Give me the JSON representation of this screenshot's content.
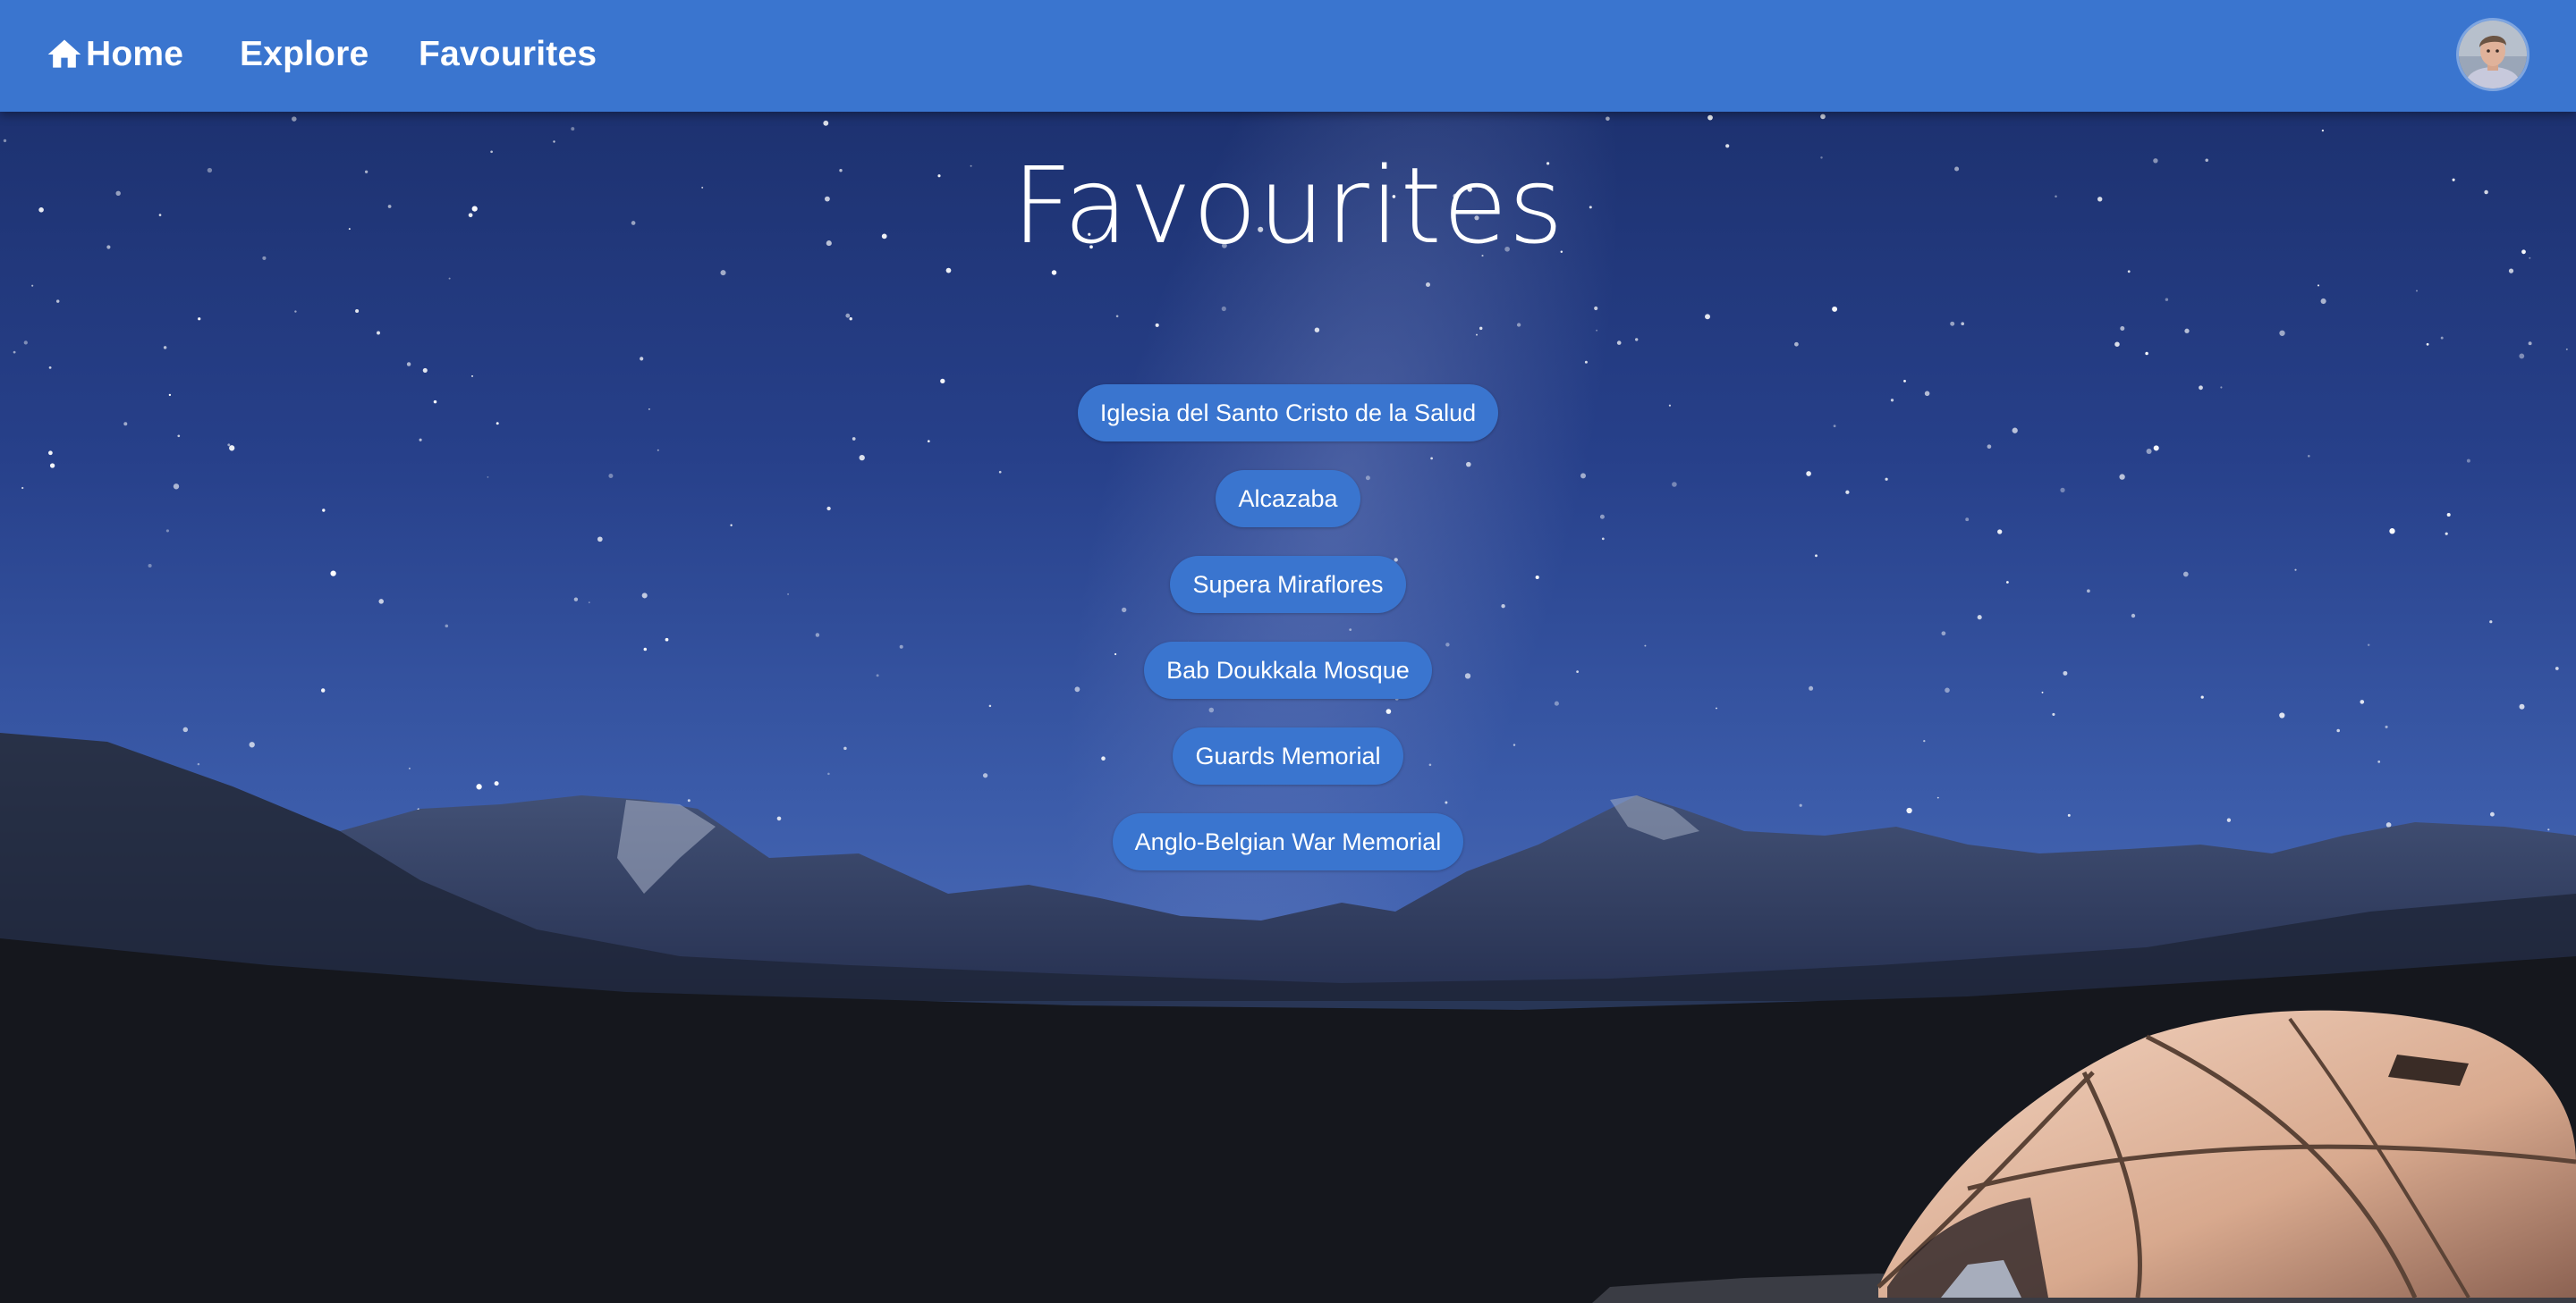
{
  "nav": {
    "home_label": "Home",
    "explore_label": "Explore",
    "favourites_label": "Favourites",
    "home_icon": "home-icon",
    "avatar_icon": "user-avatar"
  },
  "main": {
    "title": "Favourites",
    "favourites": [
      "Iglesia del Santo Cristo de la Salud",
      "Alcazaba",
      "Supera Miraflores",
      "Bab Doukkala Mosque",
      "Guards Memorial",
      "Anglo-Belgian War Memorial"
    ]
  },
  "colors": {
    "navbar": "#3a75cf",
    "chip": "#3a75cf",
    "text": "#ffffff",
    "sky_top": "#1b2f6a",
    "sky_bottom": "#4a6bb5",
    "ground": "#15171d"
  }
}
